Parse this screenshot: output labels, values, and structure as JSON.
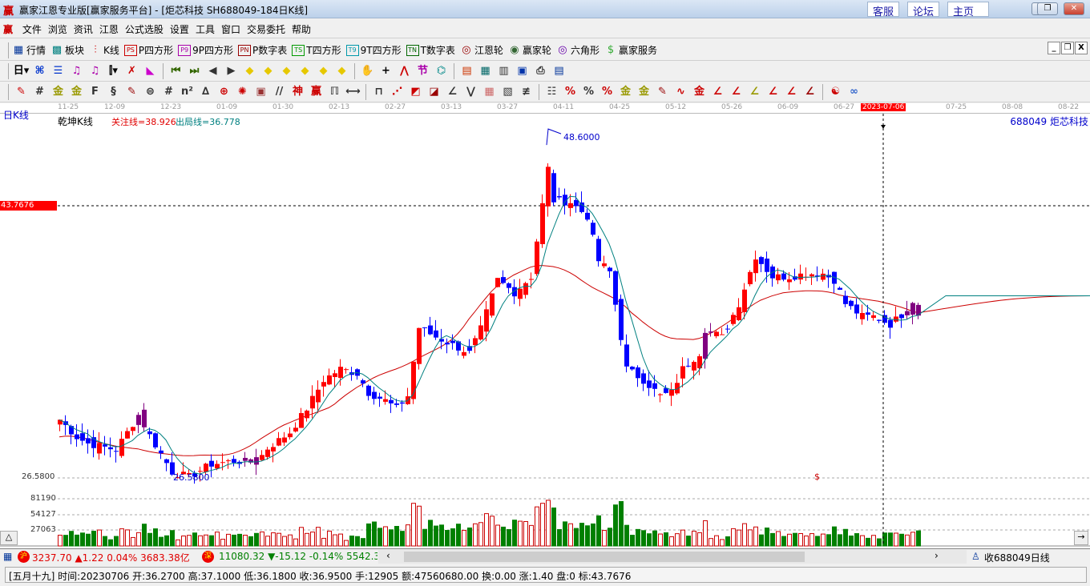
{
  "window": {
    "logo": "赢",
    "title": "赢家江恩专业版[赢家服务平台] - [炬芯科技  SH688049-184日K线]",
    "links": [
      "客服",
      "论坛",
      "主页"
    ],
    "controls": [
      "—",
      "❐",
      "✕"
    ]
  },
  "menu": {
    "logo": "赢",
    "items": [
      "文件",
      "浏览",
      "资讯",
      "江恩",
      "公式选股",
      "设置",
      "工具",
      "窗口",
      "交易委托",
      "帮助"
    ],
    "mdi_controls": [
      "_",
      "❐",
      "X"
    ]
  },
  "toolbar1": [
    {
      "icon": "grid-icon",
      "glyph": "▦",
      "color": "#003399",
      "label": "行情"
    },
    {
      "icon": "blocks-icon",
      "glyph": "▩",
      "color": "#008080",
      "label": "板块"
    },
    {
      "icon": "kline-icon",
      "glyph": "⫶",
      "color": "#cc0000",
      "label": "K线"
    },
    {
      "icon": "ps-icon",
      "glyph": "PS",
      "color": "#cc0000",
      "label": "P四方形"
    },
    {
      "icon": "p9-icon",
      "glyph": "P9",
      "color": "#aa00aa",
      "label": "9P四方形"
    },
    {
      "icon": "pn-icon",
      "glyph": "PN",
      "color": "#990000",
      "label": "P数字表"
    },
    {
      "icon": "ts-icon",
      "glyph": "TS",
      "color": "#009900",
      "label": "T四方形"
    },
    {
      "icon": "t9-icon",
      "glyph": "T9",
      "color": "#0099aa",
      "label": "9T四方形"
    },
    {
      "icon": "tn-icon",
      "glyph": "TN",
      "color": "#006600",
      "label": "T数字表"
    },
    {
      "icon": "gann-wheel-icon",
      "glyph": "◎",
      "color": "#990000",
      "label": "江恩轮"
    },
    {
      "icon": "winner-wheel-icon",
      "glyph": "◉",
      "color": "#336633",
      "label": "赢家轮"
    },
    {
      "icon": "hexagon-icon",
      "glyph": "◎",
      "color": "#6600aa",
      "label": "六角形"
    },
    {
      "icon": "dollar-icon",
      "glyph": "$",
      "color": "#33aa33",
      "label": "赢家服务"
    }
  ],
  "toolbar2": [
    {
      "n": "period-day-icon",
      "g": "日▾",
      "c": "#000"
    },
    {
      "n": "kline-mode-icon",
      "g": "⌘",
      "c": "#0033cc"
    },
    {
      "n": "notes-icon",
      "g": "☰",
      "c": "#0033cc"
    },
    {
      "n": "indicator3-icon",
      "g": "♫",
      "c": "#aa00aa"
    },
    {
      "n": "indicator9-icon",
      "g": "♫",
      "c": "#aa00aa"
    },
    {
      "n": "candle-type-icon",
      "g": "⫿▾",
      "c": "#000"
    },
    {
      "n": "fx-icon",
      "g": "✗",
      "c": "#cc0000"
    },
    {
      "n": "color-chart-icon",
      "g": "◣",
      "c": "#cc00cc"
    },
    {
      "n": "first-icon",
      "g": "⏮",
      "c": "#336600"
    },
    {
      "n": "last-icon",
      "g": "⏭",
      "c": "#336600"
    },
    {
      "n": "prev-icon",
      "g": "◀",
      "c": "#333"
    },
    {
      "n": "next-icon",
      "g": "▶",
      "c": "#333"
    },
    {
      "n": "zoom-left-icon",
      "g": "◆",
      "c": "#e6c800"
    },
    {
      "n": "zoom-right-icon",
      "g": "◆",
      "c": "#e6c800"
    },
    {
      "n": "expand-icon",
      "g": "◆",
      "c": "#e6c800"
    },
    {
      "n": "shrink-icon",
      "g": "◆",
      "c": "#e6c800"
    },
    {
      "n": "vexpand-icon",
      "g": "◆",
      "c": "#e6c800"
    },
    {
      "n": "vshrink-icon",
      "g": "◆",
      "c": "#e6c800"
    },
    {
      "n": "hand-icon",
      "g": "✋",
      "c": "#333"
    },
    {
      "n": "crosshair-icon",
      "g": "+",
      "c": "#000"
    },
    {
      "n": "draw-line-icon",
      "g": "⋀",
      "c": "#cc0000"
    },
    {
      "n": "festival-icon",
      "g": "节",
      "c": "#aa00aa"
    },
    {
      "n": "cycle-icon",
      "g": "⌬",
      "c": "#008888"
    },
    {
      "n": "calendar-icon",
      "g": "▤",
      "c": "#cc3300"
    },
    {
      "n": "calculator-icon",
      "g": "▦",
      "c": "#006666"
    },
    {
      "n": "report-icon",
      "g": "▥",
      "c": "#333"
    },
    {
      "n": "save-icon",
      "g": "▣",
      "c": "#0033aa"
    },
    {
      "n": "print-icon",
      "g": "⎙",
      "c": "#333"
    },
    {
      "n": "network-icon",
      "g": "▤",
      "c": "#003399"
    }
  ],
  "toolbar3": [
    {
      "n": "pen-icon",
      "g": "✎",
      "c": "#cc0000"
    },
    {
      "n": "lines-icon",
      "g": "#",
      "c": "#333"
    },
    {
      "n": "gold-lines-icon",
      "g": "金",
      "c": "#999900"
    },
    {
      "n": "gold-lines2-icon",
      "g": "金",
      "c": "#999900"
    },
    {
      "n": "f-lines-icon",
      "g": "F",
      "c": "#333"
    },
    {
      "n": "spiral-icon",
      "g": "§",
      "c": "#333"
    },
    {
      "n": "pen2-icon",
      "g": "✎",
      "c": "#990000"
    },
    {
      "n": "circle-lines-icon",
      "g": "⊜",
      "c": "#333"
    },
    {
      "n": "hash-icon",
      "g": "#",
      "c": "#333"
    },
    {
      "n": "n2-icon",
      "g": "n²",
      "c": "#333"
    },
    {
      "n": "fan-icon",
      "g": "∆",
      "c": "#333"
    },
    {
      "n": "target-icon",
      "g": "⊕",
      "c": "#cc0000"
    },
    {
      "n": "radar-icon",
      "g": "✺",
      "c": "#cc0000"
    },
    {
      "n": "square-target-icon",
      "g": "▣",
      "c": "#993333"
    },
    {
      "n": "parallel-icon",
      "g": "//",
      "c": "#333"
    },
    {
      "n": "shen-icon",
      "g": "神",
      "c": "#cc0000"
    },
    {
      "n": "ying-icon",
      "g": "赢",
      "c": "#cc0000"
    },
    {
      "n": "comb-icon",
      "g": "ℿ",
      "c": "#333"
    },
    {
      "n": "width-icon",
      "g": "⟷",
      "c": "#333"
    },
    {
      "n": "box-icon",
      "g": "⊓",
      "c": "#333"
    },
    {
      "n": "ray-fan-icon",
      "g": "⋰",
      "c": "#cc0000"
    },
    {
      "n": "arc-box-icon",
      "g": "◩",
      "c": "#cc0000"
    },
    {
      "n": "diag-box-icon",
      "g": "◪",
      "c": "#990000"
    },
    {
      "n": "angle-icon",
      "g": "∠",
      "c": "#333"
    },
    {
      "n": "zigzag-icon",
      "g": "⋁",
      "c": "#333"
    },
    {
      "n": "grid-box-icon",
      "g": "▦",
      "c": "#cc6666"
    },
    {
      "n": "grid-diag-icon",
      "g": "▧",
      "c": "#333"
    },
    {
      "n": "slash-lines-icon",
      "g": "≢",
      "c": "#333"
    },
    {
      "n": "bars-icon",
      "g": "☷",
      "c": "#333"
    },
    {
      "n": "percent-red-icon",
      "g": "%",
      "c": "#cc0000"
    },
    {
      "n": "percent-icon",
      "g": "%",
      "c": "#333"
    },
    {
      "n": "percent-lines-icon",
      "g": "%",
      "c": "#cc0000"
    },
    {
      "n": "gold-coin-icon",
      "g": "金",
      "c": "#999900"
    },
    {
      "n": "gold-lines3-icon",
      "g": "金",
      "c": "#999900"
    },
    {
      "n": "pen-lines-icon",
      "g": "✎",
      "c": "#990000"
    },
    {
      "n": "wave-icon",
      "g": "∿",
      "c": "#cc0000"
    },
    {
      "n": "gold-red-icon",
      "g": "金",
      "c": "#cc0000"
    },
    {
      "n": "j-angle-icon",
      "g": "∠",
      "c": "#cc0000"
    },
    {
      "n": "f-angle-icon",
      "g": "∠",
      "c": "#cc0000"
    },
    {
      "n": "gold-angle-icon",
      "g": "∠",
      "c": "#999900"
    },
    {
      "n": "shen-angle-icon",
      "g": "∠",
      "c": "#cc0000"
    },
    {
      "n": "ying-angle-icon",
      "g": "∠",
      "c": "#cc0000"
    },
    {
      "n": "four-angle-icon",
      "g": "∠",
      "c": "#990000"
    },
    {
      "n": "yinyang-icon",
      "g": "☯",
      "c": "#cc0000"
    },
    {
      "n": "infinity-icon",
      "g": "∞",
      "c": "#3366cc"
    }
  ],
  "date_axis": {
    "labels": [
      "11-25",
      "12-09",
      "12-23",
      "01-09",
      "01-30",
      "02-13",
      "02-27",
      "03-13",
      "03-27",
      "04-11",
      "04-25",
      "05-12",
      "05-26",
      "06-09",
      "06-27",
      "2023-07-06",
      "07-25",
      "08-08",
      "08-22"
    ],
    "cursor_date": "2023-07-06"
  },
  "chart_header": {
    "period": "日K线",
    "indicator": "乾坤K线",
    "focus_line": "关注线=38.926",
    "exit_line": "出局线=36.778",
    "stock": "688049  炬芯科技"
  },
  "price_axis": {
    "cursor_price": "43.7676",
    "low_label": "26.5800",
    "high_mark": "48.6000",
    "low_mark": "26.5800",
    "dollar_mark": "$"
  },
  "volume_axis": {
    "labels": [
      "81190",
      "54127",
      "27063"
    ],
    "toggle": "△",
    "arrow": "→"
  },
  "colors": {
    "up": "#ff0000",
    "down": "#0000ff",
    "neutral": "#800080",
    "ma_short": "#008080",
    "ma_long": "#cc0000",
    "vol_up": "#cc0000",
    "vol_down": "#008000"
  },
  "chart_data": {
    "type": "candlestick",
    "candle_count": 154,
    "close_keypoints": [
      [
        0,
        30.3
      ],
      [
        3,
        29.2
      ],
      [
        5,
        28.8
      ],
      [
        10,
        28.4
      ],
      [
        14,
        30.6
      ],
      [
        16,
        29.3
      ],
      [
        20,
        27.0
      ],
      [
        23,
        26.7
      ],
      [
        27,
        27.5
      ],
      [
        31,
        27.7
      ],
      [
        35,
        27.6
      ],
      [
        37,
        28.5
      ],
      [
        41,
        29.5
      ],
      [
        44,
        31.0
      ],
      [
        47,
        32.8
      ],
      [
        50,
        33.5
      ],
      [
        53,
        33.2
      ],
      [
        55,
        32.0
      ],
      [
        58,
        31.5
      ],
      [
        60,
        31.0
      ],
      [
        62,
        31.8
      ],
      [
        64,
        36.1
      ],
      [
        67,
        35.5
      ],
      [
        70,
        35.0
      ],
      [
        73,
        34.5
      ],
      [
        75,
        36.0
      ],
      [
        78,
        39.1
      ],
      [
        81,
        38.3
      ],
      [
        84,
        39.3
      ],
      [
        87,
        46.1
      ],
      [
        88,
        44.1
      ],
      [
        91,
        44.0
      ],
      [
        94,
        43.1
      ],
      [
        96,
        40.3
      ],
      [
        98,
        39.6
      ],
      [
        100,
        35.5
      ],
      [
        101,
        33.5
      ],
      [
        104,
        32.8
      ],
      [
        107,
        31.8
      ],
      [
        109,
        32.0
      ],
      [
        111,
        33.5
      ],
      [
        114,
        34.5
      ],
      [
        115,
        36.0
      ],
      [
        118,
        35.5
      ],
      [
        121,
        37.6
      ],
      [
        124,
        40.6
      ],
      [
        127,
        39.3
      ],
      [
        130,
        39.3
      ],
      [
        133,
        39.5
      ],
      [
        136,
        39.5
      ],
      [
        138,
        39.1
      ],
      [
        140,
        37.6
      ],
      [
        143,
        36.8
      ],
      [
        145,
        36.8
      ],
      [
        148,
        36.3
      ],
      [
        150,
        36.9
      ],
      [
        152,
        37.8
      ],
      [
        153,
        36.95
      ]
    ],
    "price_range": [
      26.58,
      48.6
    ],
    "highest": 48.6,
    "lowest": 26.58,
    "volume_ticks": [
      27063,
      54127,
      81190
    ]
  },
  "status_bar": {
    "sh_badge": "沪",
    "sh_index": "3237.70 ▲1.22 0.04% 3683.38亿",
    "sz_badge": "深",
    "sz_index": "11080.32 ▼-15.12 -0.14% 5542.38",
    "scroll_left": "‹",
    "scroll_right": "›",
    "receive": "收688049日线"
  },
  "info_bar": "[五月十九] 时间:20230706 开:36.2700 高:37.1000 低:36.1800 收:36.9500 手:12905 额:47560680.00 换:0.00 涨:1.40 盘:0 标:43.7676"
}
